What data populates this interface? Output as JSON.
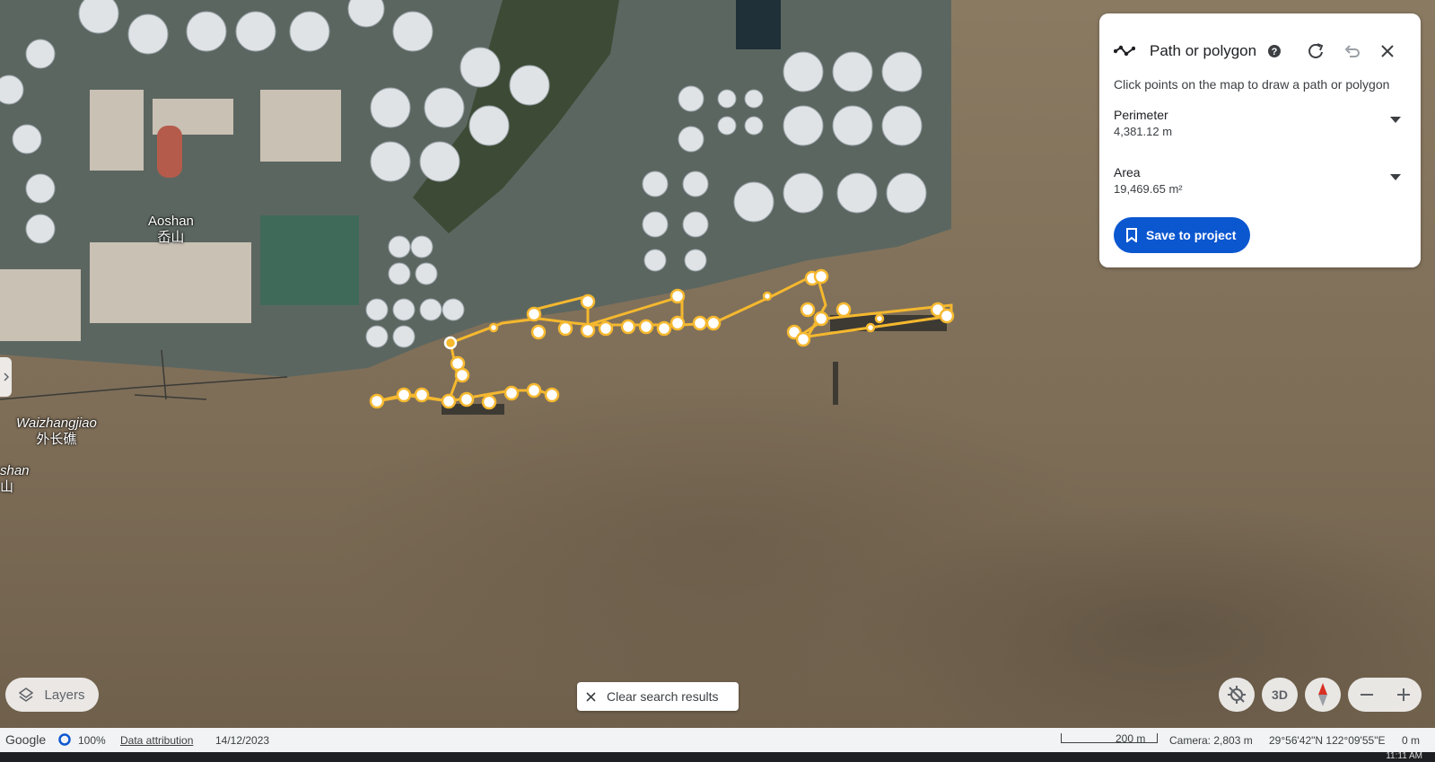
{
  "map": {
    "places": [
      {
        "en": "Aoshan",
        "zh": "岙山"
      },
      {
        "en": "Waizhangjiao",
        "zh": "外长礁"
      },
      {
        "en": "shan",
        "zh": "山"
      }
    ]
  },
  "measure_panel": {
    "title": "Path or polygon",
    "hint": "Click points on the map to draw a path or polygon",
    "perimeter_label": "Perimeter",
    "perimeter_value": "4,381.12 m",
    "area_label": "Area",
    "area_value": "19,469.65 m²",
    "save_label": "Save to project"
  },
  "layers_label": "Layers",
  "clear_search_label": "Clear search results",
  "controls": {
    "three_d_label": "3D"
  },
  "footer": {
    "brand": "Google",
    "globe_percent": "100%",
    "attribution": "Data attribution",
    "date": "14/12/2023",
    "scale": "200 m",
    "camera": "Camera: 2,803 m",
    "coords": "29°56'42\"N 122°09'55\"E",
    "elevation": "0 m"
  },
  "taskbar": {
    "time": "11:11 AM"
  },
  "colors": {
    "accent": "#0b57d0",
    "path": "#f5b82e",
    "water": "#7d6d57"
  }
}
